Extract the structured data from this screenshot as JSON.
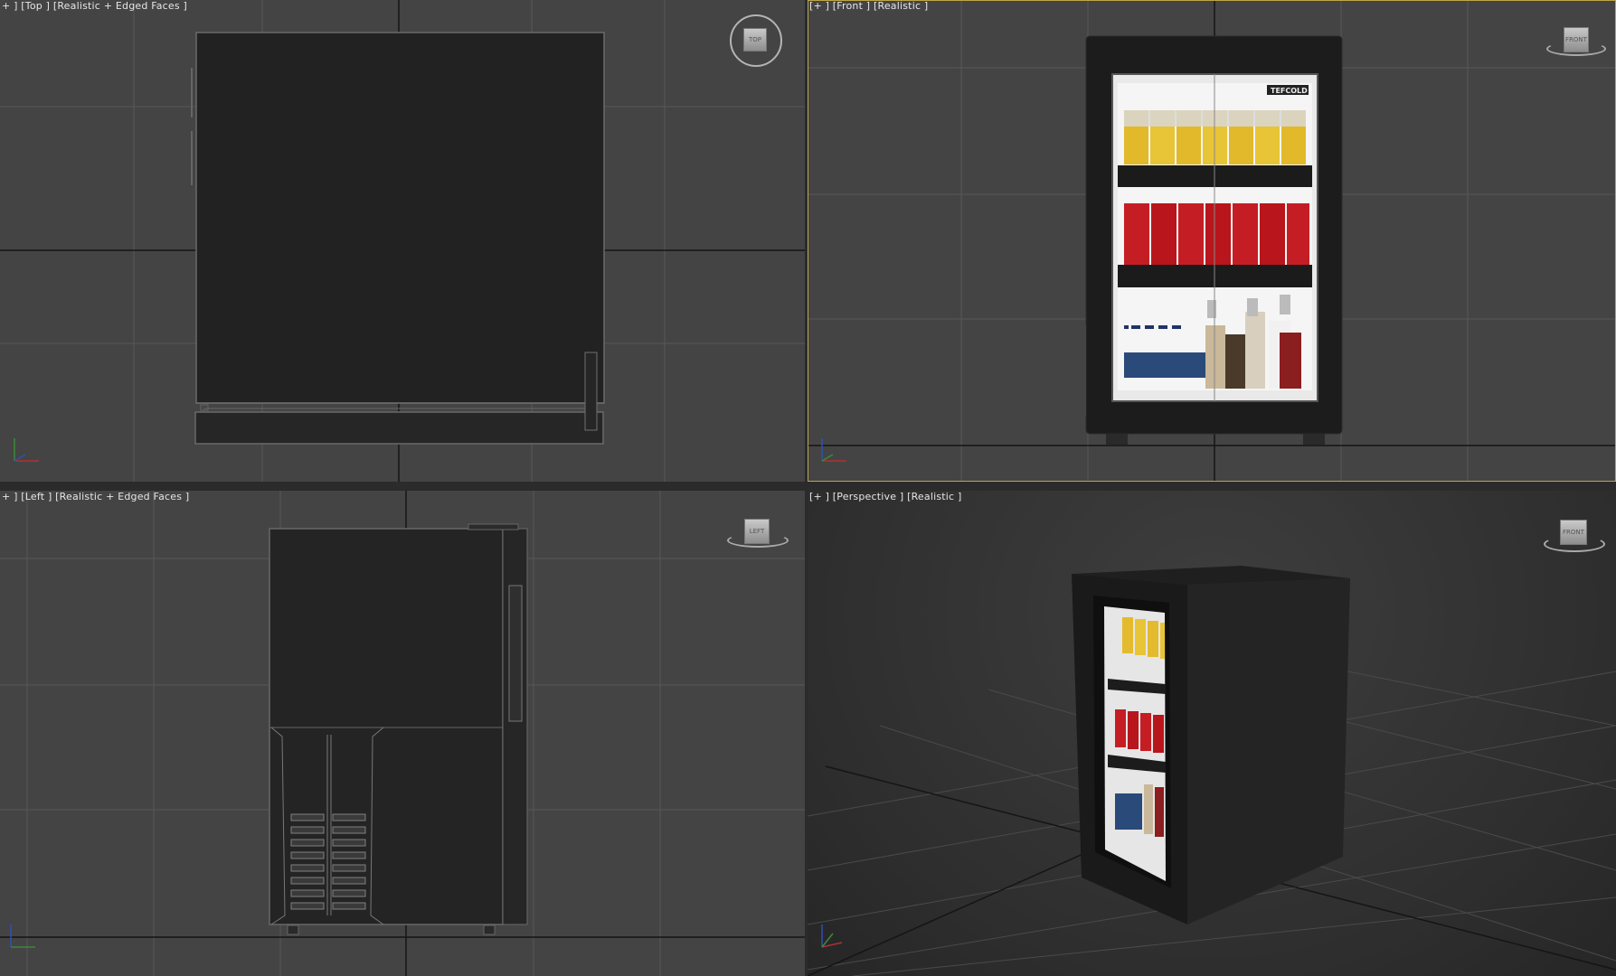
{
  "viewports": {
    "top": {
      "label": "+ ] [Top ] [Realistic + Edged Faces ]",
      "viewcube": "TOP"
    },
    "front": {
      "label": "[+ ] [Front ] [Realistic ]",
      "viewcube": "FRONT",
      "active": true
    },
    "left": {
      "label": "+ ] [Left ] [Realistic + Edged Faces ]",
      "viewcube": "LEFT"
    },
    "perspective": {
      "label": "[+ ] [Perspective ] [Realistic ]",
      "viewcube": "FRONT"
    }
  },
  "fridge": {
    "brand": "TEFCOLD",
    "shelf_items": [
      "schweppes-can",
      "coca-cola-can",
      "water-bottle",
      "liquor-bottle"
    ]
  },
  "colors": {
    "viewport_bg": "#444444",
    "perspective_bg": "#3a3a3a",
    "grid": "#5a5a5a",
    "axis": "#111111",
    "active_border": "#bfa64a",
    "fridge_body": "#1e1e1e"
  }
}
